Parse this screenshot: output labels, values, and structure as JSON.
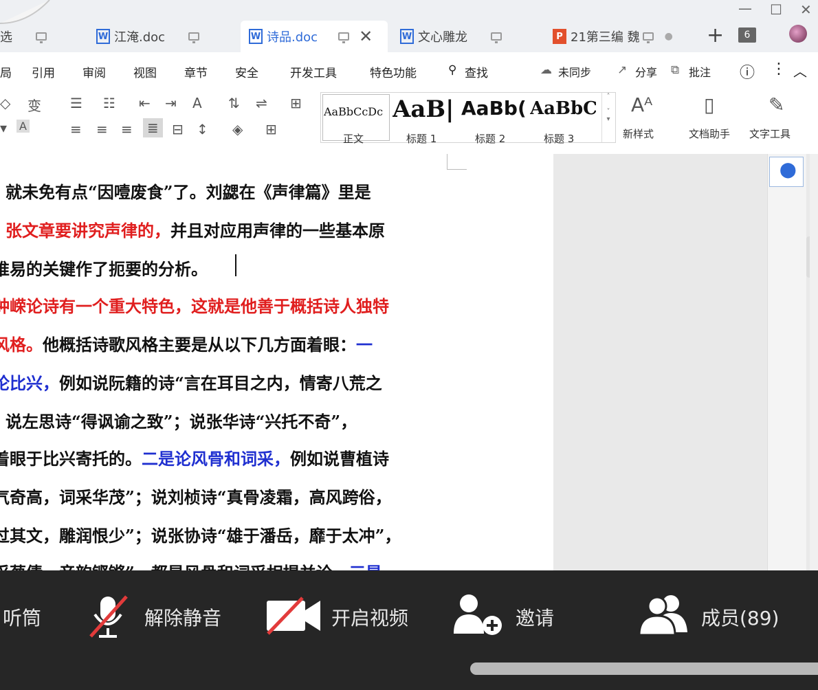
{
  "tabs": [
    {
      "label": "选"
    },
    {
      "label": "江淹.doc",
      "icon": "W"
    },
    {
      "label": "诗品.doc",
      "icon": "W",
      "active": true
    },
    {
      "label": "文心雕龙",
      "icon": "W"
    },
    {
      "label": "21第三编 魏",
      "icon": "P"
    }
  ],
  "tabbar": {
    "new_tab": "+",
    "tab_count": "6"
  },
  "menu": [
    "局",
    "引用",
    "审阅",
    "视图",
    "章节",
    "安全",
    "开发工具",
    "特色功能",
    "查找"
  ],
  "menu_right": {
    "sync": "未同步",
    "share": "分享",
    "comment": "批注"
  },
  "styles": [
    {
      "sample": "AaBbCcDc",
      "name": "正文"
    },
    {
      "sample": "AaB|",
      "name": "标题 1"
    },
    {
      "sample": "AaBb(",
      "name": "标题 2"
    },
    {
      "sample": "AaBbC",
      "name": "标题 3"
    }
  ],
  "toolbar_right": {
    "new_style": "新样式",
    "doc_helper": "文档助手",
    "text_tools": "文字工具"
  },
  "document": {
    "lines": [
      [
        {
          "t": "就未免有点“因噎废食”了。刘勰在《声律篇》里是",
          "c": "black"
        }
      ],
      [
        {
          "t": "张文章要讲究声律的，",
          "c": "red"
        },
        {
          "t": "并且对应用声律的一些基本原",
          "c": "black"
        }
      ],
      [
        {
          "t": "推易的关键作了扼要的分析。",
          "c": "black"
        }
      ],
      [
        {
          "t": "钟嵘论诗有一个重大特色，这就是他善于概括诗人独特",
          "c": "red"
        }
      ],
      [
        {
          "t": "风格。",
          "c": "red"
        },
        {
          "t": "他概括诗歌风格主要是从以下几方面着眼：",
          "c": "black"
        },
        {
          "t": "一",
          "c": "blue"
        }
      ],
      [
        {
          "t": "论比兴，",
          "c": "blue"
        },
        {
          "t": "例如说阮籍的诗“言在耳目之内，情寄八荒之",
          "c": "black"
        }
      ],
      [
        {
          "t": "说左思诗“得讽谕之致”；说张华诗“兴托不奇”，",
          "c": "black"
        }
      ],
      [
        {
          "t": "着眼于比兴寄托的。",
          "c": "black"
        },
        {
          "t": "二是论风骨和词采，",
          "c": "blue"
        },
        {
          "t": "例如说曹植诗",
          "c": "black"
        }
      ],
      [
        {
          "t": "气奇高，词采华茂”；说刘桢诗“真骨凌霜，高风跨俗，",
          "c": "black"
        }
      ],
      [
        {
          "t": "过其文，雕润恨少”；说张协诗“雄于潘岳，靡于太冲”，",
          "c": "black"
        }
      ],
      [
        {
          "t": "采葱倩，音韵铿锵”，都是风骨和词采相提并论。",
          "c": "black"
        },
        {
          "t": "三是",
          "c": "blue"
        }
      ]
    ]
  },
  "meeting": {
    "earpiece": "听筒",
    "unmute": "解除静音",
    "video": "开启视频",
    "invite": "邀请",
    "members": "成员(89)"
  },
  "colors": {
    "red": "#e01e1e",
    "blue": "#1f2fd0",
    "accent": "#2f6bd8",
    "meetbar": "#262626"
  }
}
